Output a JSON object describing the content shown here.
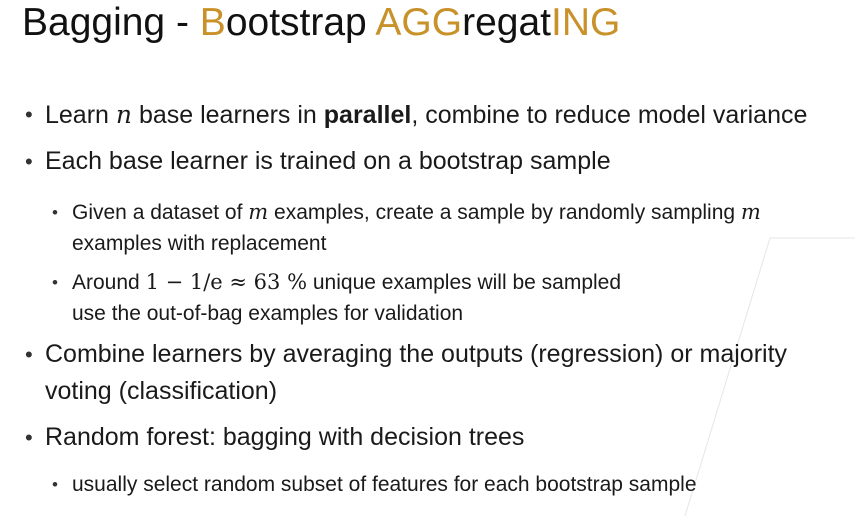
{
  "title": {
    "p1": "Bagging - ",
    "p2": "B",
    "p3": "ootstrap ",
    "p4": "AGG",
    "p5": "regat",
    "p6": "ING"
  },
  "colors": {
    "accent": "#c8912a",
    "text": "#1a1a1a",
    "decor_line": "#e0e0e0"
  },
  "bullets": {
    "b1": {
      "t1": "Learn ",
      "var": "n",
      "t2": " base learners in ",
      "bold": "parallel",
      "t3": ", combine to reduce model variance"
    },
    "b2": {
      "text": "Each base learner is trained on a bootstrap sample"
    },
    "b2a": {
      "t1": "Given a dataset of ",
      "var1": "m",
      "t2": " examples, create a sample by randomly sampling ",
      "var2": "m",
      "line2": "examples with replacement"
    },
    "b2b": {
      "t1": "Around ",
      "math": "1 − 1/e ≈ 63 %",
      "t2": " unique examples will be sampled",
      "line2": "use the out-of-bag examples for validation"
    },
    "b3": {
      "line1": "Combine learners by averaging the outputs (regression) or majority",
      "line2": "voting (classification)"
    },
    "b4": {
      "text": "Random forest: bagging with decision trees"
    },
    "b4a": {
      "text": "usually select random subset of features for each bootstrap sample"
    }
  }
}
